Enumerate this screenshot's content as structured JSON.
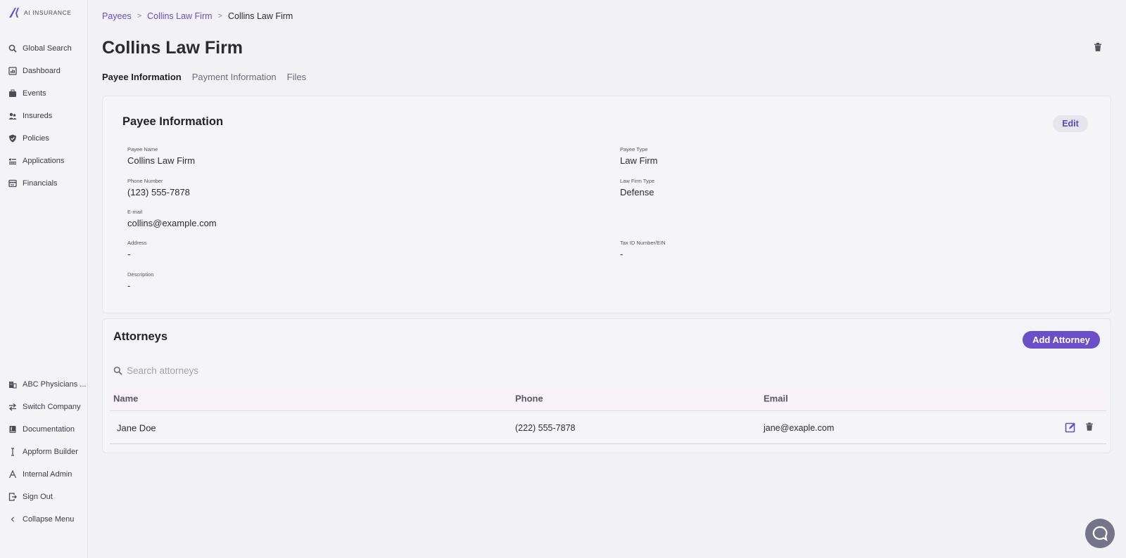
{
  "app": {
    "logo_text": "AI INSURANCE",
    "accent": "#6a4fc8"
  },
  "sidebar": {
    "items": [
      {
        "label": "Global Search",
        "icon": "search-icon"
      },
      {
        "label": "Dashboard",
        "icon": "dashboard-icon"
      },
      {
        "label": "Events",
        "icon": "events-icon"
      },
      {
        "label": "Insureds",
        "icon": "insureds-icon"
      },
      {
        "label": "Policies",
        "icon": "shield-icon"
      },
      {
        "label": "Applications",
        "icon": "applications-icon"
      },
      {
        "label": "Financials",
        "icon": "financials-icon"
      }
    ],
    "bottom_items": [
      {
        "label": "ABC Physicians ...",
        "icon": "building-icon"
      },
      {
        "label": "Switch Company",
        "icon": "switch-icon"
      },
      {
        "label": "Documentation",
        "icon": "book-icon"
      },
      {
        "label": "Appform Builder",
        "icon": "cursor-icon"
      },
      {
        "label": "Internal Admin",
        "icon": "admin-icon"
      },
      {
        "label": "Sign Out",
        "icon": "sign-out-icon"
      },
      {
        "label": "Collapse Menu",
        "icon": "chevron-left-icon"
      }
    ]
  },
  "breadcrumb": {
    "items": [
      "Payees",
      "Collins Law Firm"
    ],
    "current": "Collins Law Firm",
    "separator": ">"
  },
  "page": {
    "title": "Collins Law Firm",
    "tabs": [
      "Payee Information",
      "Payment Information",
      "Files"
    ],
    "active_tab": "Payee Information"
  },
  "payee_info": {
    "title": "Payee Information",
    "edit_label": "Edit",
    "fields": {
      "payee_name": {
        "label": "Payee Name",
        "value": "Collins Law Firm"
      },
      "payee_type": {
        "label": "Payee Type",
        "value": "Law Firm"
      },
      "phone": {
        "label": "Phone Number",
        "value": "(123) 555-7878"
      },
      "law_firm_type": {
        "label": "Law Firm Type",
        "value": "Defense"
      },
      "email": {
        "label": "E-mail",
        "value": "collins@example.com"
      },
      "address": {
        "label": "Address",
        "value": "-"
      },
      "tax_id": {
        "label": "Tax ID Number/EIN",
        "value": "-"
      },
      "description": {
        "label": "Description",
        "value": "-"
      }
    }
  },
  "attorneys": {
    "title": "Attorneys",
    "add_label": "Add Attorney",
    "search_placeholder": "Search attorneys",
    "columns": [
      "Name",
      "Phone",
      "Email"
    ],
    "rows": [
      {
        "name": "Jane Doe",
        "phone": "(222) 555-7878",
        "email": "jane@exaple.com"
      }
    ]
  }
}
